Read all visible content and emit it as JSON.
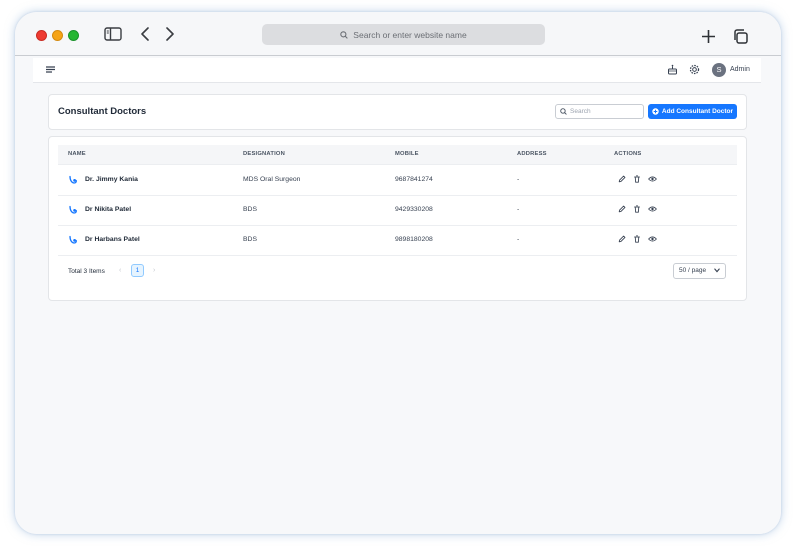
{
  "browser": {
    "url_placeholder": "Search or enter website name"
  },
  "appbar": {
    "user_initial": "S",
    "user_name": "Admin"
  },
  "page": {
    "title": "Consultant Doctors",
    "search_placeholder": "Search",
    "add_button_label": "Add Consultant Doctor",
    "accent_color": "#1677ff"
  },
  "table": {
    "columns": [
      "NAME",
      "DESIGNATION",
      "MOBILE",
      "ADDRESS",
      "ACTIONS"
    ],
    "rows": [
      {
        "name": "Dr. Jimmy Kania",
        "designation": "MDS Oral Surgeon",
        "mobile": "9687841274",
        "address": "-"
      },
      {
        "name": "Dr Nikita Patel",
        "designation": "BDS",
        "mobile": "9429330208",
        "address": "-"
      },
      {
        "name": "Dr Harbans Patel",
        "designation": "BDS",
        "mobile": "9898180208",
        "address": "-"
      }
    ],
    "row_actions": [
      "edit-icon",
      "delete-icon",
      "view-icon"
    ]
  },
  "pagination": {
    "total_text": "Total 3 Items",
    "prev": "‹",
    "current_page": "1",
    "next": "›",
    "page_size": "50 / page"
  }
}
